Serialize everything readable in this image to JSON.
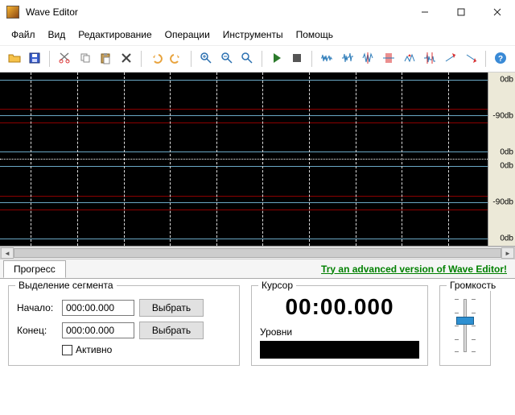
{
  "window": {
    "title": "Wave Editor"
  },
  "menu": {
    "file": "Файл",
    "view": "Вид",
    "edit": "Редактирование",
    "ops": "Операции",
    "tools": "Инструменты",
    "help": "Помощь"
  },
  "db_labels": {
    "zero": "0db",
    "neg90": "-90db"
  },
  "tabs": {
    "progress": "Прогресс",
    "promo": "Try an advanced version of Wave Editor!"
  },
  "segment": {
    "title": "Выделение сегмента",
    "start_label": "Начало:",
    "start_value": "000:00.000",
    "start_btn": "Выбрать",
    "end_label": "Конец:",
    "end_value": "000:00.000",
    "end_btn": "Выбрать",
    "active": "Активно"
  },
  "cursor": {
    "title": "Курсор",
    "time": "00:00.000",
    "levels_label": "Уровни"
  },
  "volume": {
    "title": "Громкость"
  },
  "icons": {
    "open": "open-icon",
    "save": "save-icon",
    "cut": "cut-icon",
    "copy": "copy-icon",
    "paste": "paste-icon",
    "delete": "delete-icon",
    "undo": "undo-icon",
    "redo": "redo-icon",
    "zoomin": "zoomin-icon",
    "zoomout": "zoomout-icon",
    "zoomfit": "zoomfit-icon",
    "play": "play-icon",
    "stop": "stop-icon",
    "w1": "wave-tool-1",
    "w2": "wave-tool-2",
    "w3": "wave-tool-3",
    "w4": "wave-tool-4",
    "w5": "wave-tool-5",
    "w6": "wave-tool-6",
    "w7": "wave-tool-7",
    "w8": "wave-tool-8",
    "helpbtn": "help-icon"
  }
}
